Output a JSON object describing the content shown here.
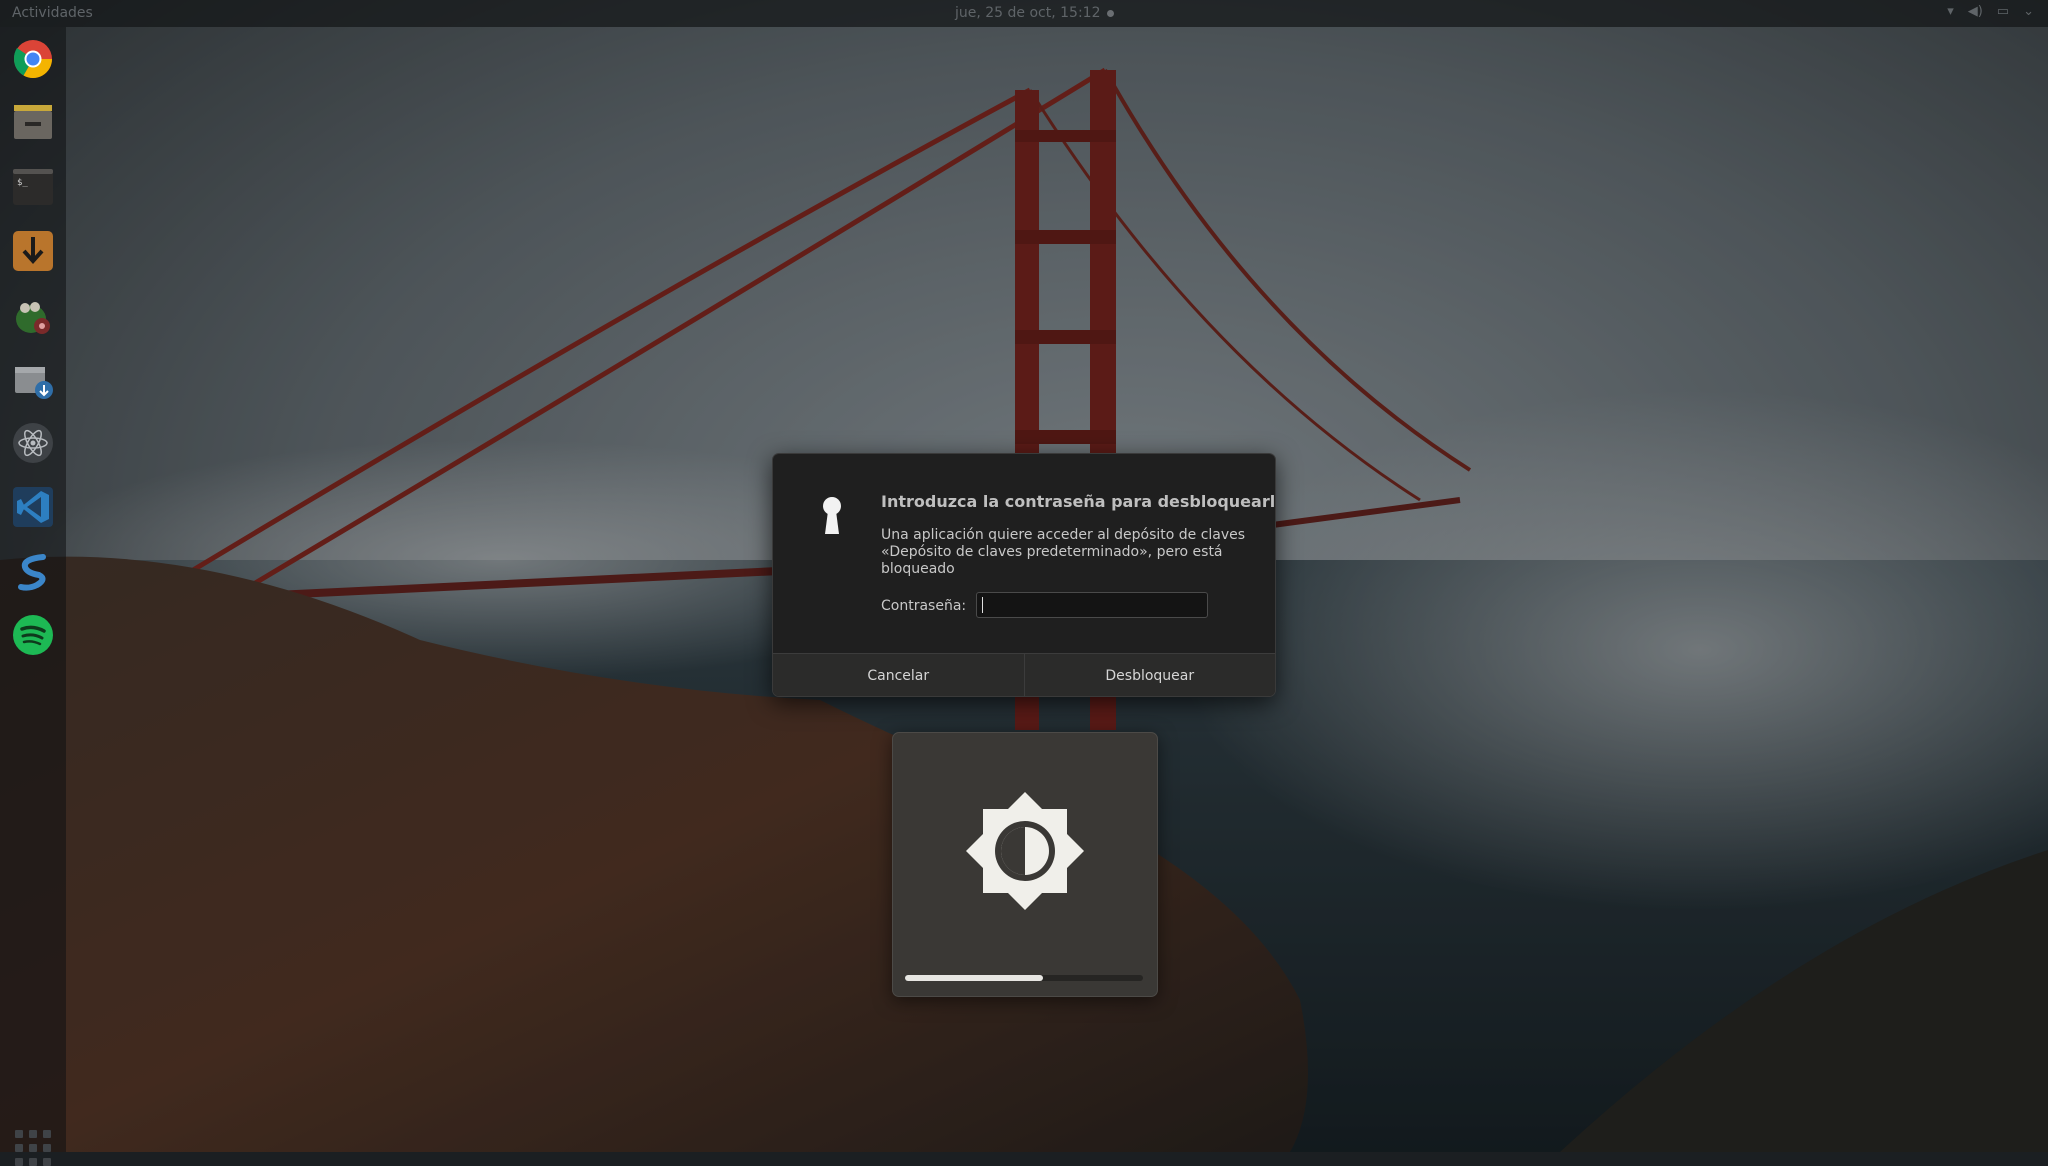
{
  "topbar": {
    "activities_label": "Actividades",
    "clock": "jue, 25 de oct, 15:12"
  },
  "dock": {
    "items": [
      {
        "name": "chrome",
        "icon": "chrome-icon"
      },
      {
        "name": "files",
        "icon": "files-icon"
      },
      {
        "name": "terminal",
        "icon": "terminal-icon"
      },
      {
        "name": "downloader",
        "icon": "download-arrow-icon"
      },
      {
        "name": "gimp",
        "icon": "gimp-icon"
      },
      {
        "name": "software-updater",
        "icon": "package-update-icon"
      },
      {
        "name": "atom",
        "icon": "atom-icon"
      },
      {
        "name": "vscode",
        "icon": "vscode-icon"
      },
      {
        "name": "scale",
        "icon": "s-logo-icon"
      },
      {
        "name": "spotify",
        "icon": "spotify-icon"
      }
    ],
    "apps_grid_icon": "show-applications-icon"
  },
  "dialog": {
    "icon": "keyhole-icon",
    "title": "Introduzca la contraseña para desbloquearlo",
    "message": "Una aplicación quiere acceder al depósito de claves «Depósito de claves predeterminado», pero está bloqueado",
    "password_label": "Contraseña:",
    "password_value": "",
    "cancel_label": "Cancelar",
    "unlock_label": "Desbloquear"
  },
  "osd": {
    "icon": "brightness-icon",
    "level": 0.58
  },
  "colors": {
    "dialog_bg": "#1f1f1f",
    "button_bar": "#2b2b2a",
    "osd_bg": "#3a3835",
    "chrome_red": "#db4437",
    "spotify_green": "#1db954"
  }
}
